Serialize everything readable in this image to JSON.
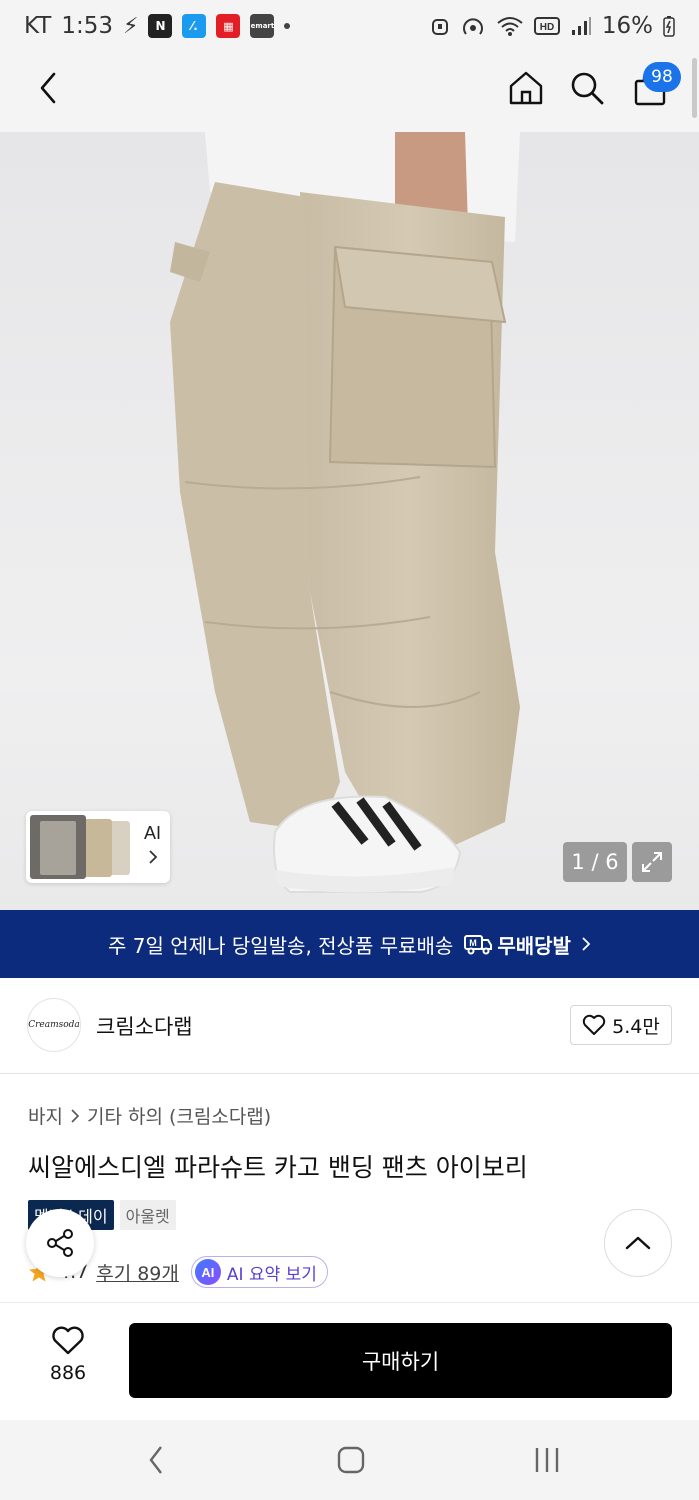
{
  "status_bar": {
    "carrier": "KT",
    "time": "1:53",
    "apps": [
      {
        "label": "N",
        "color": "#222222"
      },
      {
        "label": "⁄.",
        "color": "#1a9bf0"
      },
      {
        "label": "▦",
        "color": "#e41e26"
      },
      {
        "label": "emart",
        "color": "#444444"
      }
    ],
    "battery": "16%"
  },
  "header": {
    "cart_count": "98"
  },
  "gallery": {
    "ai_label": "AI",
    "counter": "1 / 6"
  },
  "promo": {
    "text": "주 7일 언제나 당일발송, 전상품 무료배송",
    "badge": "무배당발"
  },
  "brand": {
    "logo_text": "Creamsoda",
    "name": "크림소다랩",
    "likes": "5.4만"
  },
  "product": {
    "breadcrumb": [
      "바지",
      "기타 하의 (크림소다랩)"
    ],
    "title": "씨알에스디엘 파라슈트 카고 밴딩 팬츠 아이보리",
    "tags": [
      "멤버스데이",
      "아울렛"
    ],
    "rating": "4.7",
    "reviews": "후기 89개",
    "ai_summary": "AI 요약 보기",
    "ai_badge": "AI"
  },
  "purchase_bar": {
    "wish_count": "886",
    "buy_label": "구매하기"
  },
  "colors": {
    "accent": "#1a73e8",
    "promo_bg": "#0d2b7d",
    "buy_bg": "#000000"
  }
}
